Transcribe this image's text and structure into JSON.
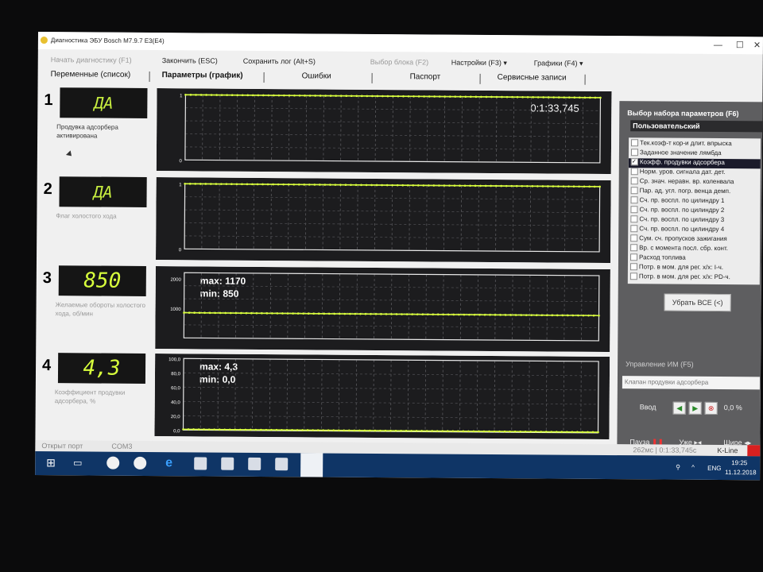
{
  "window": {
    "title": "Диагностика ЭБУ Bosch M7.9.7 E3(E4)"
  },
  "menu": {
    "start": "Начать диагностику (F1)",
    "finish": "Закончить (ESC)",
    "save_log": "Сохранить лог (Alt+S)",
    "select_block": "Выбор блока (F2)",
    "settings": "Настройки (F3)",
    "graphs": "Графики (F4)"
  },
  "tabs": [
    "Переменные (список)",
    "Параметры (график)",
    "Ошибки",
    "Паспорт",
    "Сервисные записи"
  ],
  "panels": [
    {
      "index": "1",
      "value": "ДА",
      "label": "Продувка адсорбера активирована",
      "time": "0:1:33,745",
      "y_ticks": [
        "1",
        "0"
      ]
    },
    {
      "index": "2",
      "value": "ДА",
      "label": "Флаг холостого хода",
      "y_ticks": [
        "1",
        "0"
      ]
    },
    {
      "index": "3",
      "value": "850",
      "label": "Желаемые обороты холостого хода, об/мин",
      "max": "max: 1170",
      "min": "min: 850",
      "y_ticks": [
        "2000",
        "1000"
      ]
    },
    {
      "index": "4",
      "value": "4,3",
      "label": "Коэффициент продувки адсорбера, %",
      "max": "max: 4,3",
      "min": "min: 0,0",
      "y_ticks": [
        "100,0",
        "80,0",
        "60,0",
        "40,0",
        "20,0",
        "0,0"
      ]
    }
  ],
  "chart_data": [
    {
      "type": "line",
      "title": "",
      "ylim": [
        0,
        1
      ],
      "series": [
        {
          "x": [
            0,
            1
          ],
          "values": [
            1,
            1
          ]
        }
      ]
    },
    {
      "type": "line",
      "title": "",
      "ylim": [
        0,
        1
      ],
      "series": [
        {
          "x": [
            0,
            1
          ],
          "values": [
            1,
            1
          ]
        }
      ]
    },
    {
      "type": "line",
      "title": "",
      "ylim": [
        0,
        2200
      ],
      "series": [
        {
          "x": [
            0,
            1
          ],
          "values": [
            850,
            850
          ]
        }
      ]
    },
    {
      "type": "line",
      "title": "",
      "ylim": [
        0,
        100
      ],
      "series": [
        {
          "x": [
            0,
            1
          ],
          "values": [
            1,
            1
          ]
        }
      ]
    }
  ],
  "param_set": {
    "header": "Выбор набора параметров (F6)",
    "selected": "Пользовательский",
    "items": [
      {
        "label": "Тек.коэф-т кор-и длит. впрыска",
        "checked": false
      },
      {
        "label": "Заданное значение лямбда",
        "checked": false
      },
      {
        "label": "Коэфф. продувки адсорбера",
        "checked": true,
        "selected": true
      },
      {
        "label": "Норм. уров. сигнала дат. дет.",
        "checked": false
      },
      {
        "label": "Ср. знач. неравн. вр. коленвала",
        "checked": false
      },
      {
        "label": "Пар. ад. угл. погр. венца демп.",
        "checked": false
      },
      {
        "label": "Сч. пр. воспл. по цилиндру 1",
        "checked": false
      },
      {
        "label": "Сч. пр. воспл. по цилиндру 2",
        "checked": false
      },
      {
        "label": "Сч. пр. воспл. по цилиндру 3",
        "checked": false
      },
      {
        "label": "Сч. пр. воспл. по цилиндру 4",
        "checked": false
      },
      {
        "label": "Сум. сч. пропусков зажигания",
        "checked": false
      },
      {
        "label": "Вр. с момента посл. сбр. конт.",
        "checked": false
      },
      {
        "label": "Расход топлива",
        "checked": false
      },
      {
        "label": "Потр. в мом. для рег. х/х: I-ч.",
        "checked": false
      },
      {
        "label": "Потр. в мом. для рег. х/х: PD-ч.",
        "checked": false
      }
    ],
    "clear_all": "Убрать ВСЕ (<)"
  },
  "actuator": {
    "header": "Управление ИМ (F5)",
    "field": "Клапан продувки адсорбера",
    "input_label": "Ввод",
    "percent": "0,0 %",
    "pause": "Пауза",
    "narrower": "Уже",
    "wider": "Шире"
  },
  "status": {
    "port": "Открыт порт",
    "com": "COM3",
    "timing": "262мс | 0:1:33,745с",
    "kline": "K-Line"
  },
  "taskbar": {
    "lang": "ENG",
    "time": "19:25",
    "date": "11.12.2018"
  },
  "colors": {
    "trace": "#d9ff3c",
    "lcd_bg": "#151515",
    "chart_bg": "#1c1c1e"
  }
}
